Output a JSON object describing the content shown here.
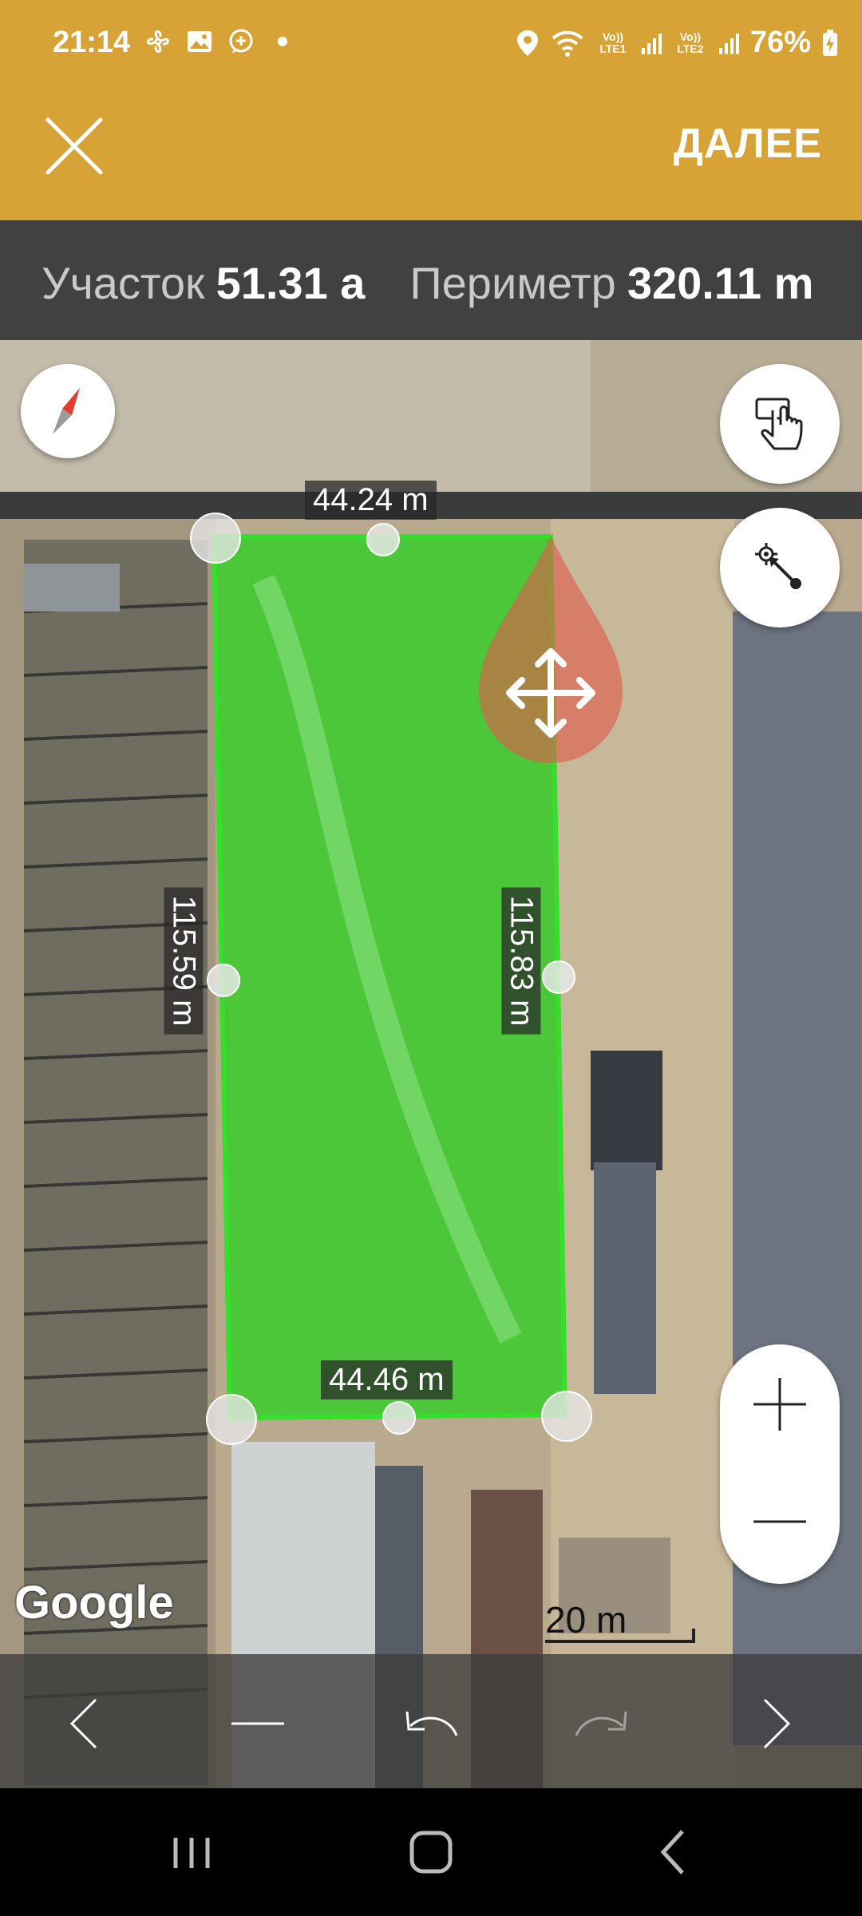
{
  "status_bar": {
    "time": "21:14",
    "left_icons": [
      "fan-icon",
      "image-icon",
      "chat-plus-icon",
      "dot-icon"
    ],
    "sim1": "Vo)) LTE1",
    "sim2": "Vo)) LTE2",
    "battery": "76%",
    "right_icons": [
      "location-icon",
      "wifi-icon",
      "signal-icon",
      "battery-charging-icon"
    ]
  },
  "app_bar": {
    "close_icon": "close-icon",
    "next_label": "ДАЛЕЕ"
  },
  "info": {
    "area_label": "Участок",
    "area_value": "51.31 a",
    "perimeter_label": "Периметр",
    "perimeter_value": "320.11 m"
  },
  "map": {
    "edges": {
      "top": "44.24 m",
      "left": "115.59 m",
      "right": "115.83 m",
      "bottom": "44.46 m"
    },
    "polygon_color": "#33e02a",
    "move_marker_color": "#e05a4a",
    "attribution": "Google",
    "scale": "20 m",
    "controls": [
      "compass-icon",
      "hand-touch-icon",
      "measure-point-icon",
      "zoom-in-icon",
      "zoom-out-icon"
    ]
  },
  "toolbar": {
    "icons": [
      "chevron-left-icon",
      "minus-icon",
      "undo-icon",
      "redo-icon",
      "chevron-right-icon"
    ]
  },
  "nav_bar": {
    "icons": [
      "recents-icon",
      "home-icon",
      "back-icon"
    ]
  },
  "colors": {
    "accent": "#d7a236",
    "info_bar": "#464646"
  }
}
